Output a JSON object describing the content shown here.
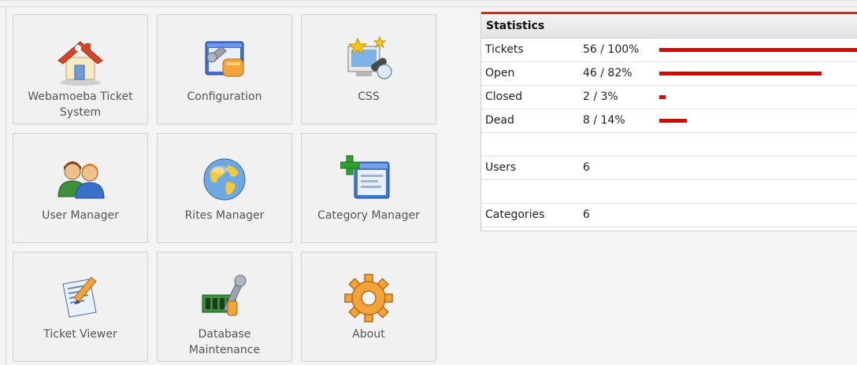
{
  "tiles": [
    {
      "label": "Webamoeba Ticket System",
      "icon": "home-icon"
    },
    {
      "label": "Configuration",
      "icon": "configuration-icon"
    },
    {
      "label": "CSS",
      "icon": "css-icon"
    },
    {
      "label": "User Manager",
      "icon": "users-icon"
    },
    {
      "label": "Rites Manager",
      "icon": "globe-icon"
    },
    {
      "label": "Category Manager",
      "icon": "category-icon"
    },
    {
      "label": "Ticket Viewer",
      "icon": "ticket-icon"
    },
    {
      "label": "Database Maintenance",
      "icon": "database-icon"
    },
    {
      "label": "About",
      "icon": "about-gear-icon"
    }
  ],
  "statistics": {
    "title": "Statistics",
    "accent_color": "#e00000",
    "rows": [
      {
        "name": "Tickets",
        "value": "56 / 100%",
        "bar_percent": 100
      },
      {
        "name": "Open",
        "value": "46 / 82%",
        "bar_percent": 82
      },
      {
        "name": "Closed",
        "value": "2 / 3%",
        "bar_percent": 3
      },
      {
        "name": "Dead",
        "value": "8 / 14%",
        "bar_percent": 14
      },
      {
        "name": "",
        "value": ""
      },
      {
        "name": "Users",
        "value": "6"
      },
      {
        "name": "",
        "value": ""
      },
      {
        "name": "Categories",
        "value": "6"
      }
    ]
  }
}
